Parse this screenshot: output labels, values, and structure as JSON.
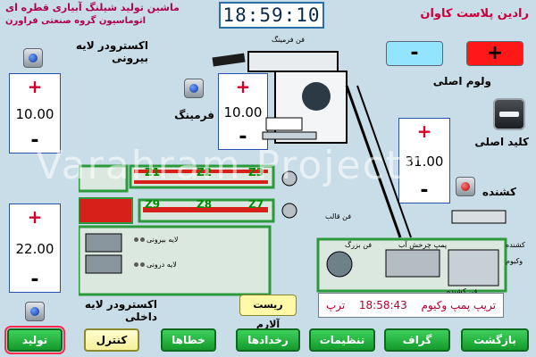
{
  "header": {
    "machine_name": "ماشین تولید شیلنگ آبیاری قطره ای",
    "automation_group": "اتوماسیون گروه صنعتی فراورن",
    "clock": "18:59:10",
    "brand": "رادین پلاست کاوان"
  },
  "main_volume": {
    "label": "ولوم اصلی",
    "minus": "-",
    "plus": "+"
  },
  "main_key": {
    "label": "کلید اصلی"
  },
  "outer_extruder": {
    "label": "اکسترودر لایه بیرونی",
    "plus": "+",
    "value": "10.00",
    "minus": "-"
  },
  "forming": {
    "label": "فرمینگ",
    "plus": "+",
    "value": "10.00",
    "minus": "-",
    "fan_label": "فن فرمینگ"
  },
  "puller": {
    "label": "کشنده",
    "plus": "+",
    "value": "31.00",
    "minus": "-"
  },
  "inner_extruder": {
    "label": "اکسترودر لایه داخلی",
    "plus": "+",
    "value": "22.00",
    "minus": "-"
  },
  "zones_top": [
    "Z1",
    "Z2",
    "Z3"
  ],
  "zones_bottom": [
    "Z9",
    "Z8",
    "Z7"
  ],
  "heater_panel": {
    "outer_layer": "لایه بیرونی",
    "inner_layer": "لایه درونی"
  },
  "machine_labels": {
    "fan_mold": "فن قالب",
    "big_fan": "فن بزرگ",
    "water_pump": "پمپ چرخش آب",
    "puller_small": "کشنده",
    "vacuum": "وکیوم",
    "fan_puller": "فن کشنده"
  },
  "alarm_reset": "ریست آلارم",
  "message": {
    "time": "18:58:43",
    "text": "تریپ پمپ وکیوم",
    "unit": "ترپ"
  },
  "watermark": "Varahram Projects",
  "nav": [
    {
      "label": "تولید",
      "key": "production"
    },
    {
      "label": "کنترل",
      "key": "control"
    },
    {
      "label": "خطاها",
      "key": "errors"
    },
    {
      "label": "رخدادها",
      "key": "events"
    },
    {
      "label": "تنظیمات",
      "key": "settings"
    },
    {
      "label": "گراف",
      "key": "graph"
    },
    {
      "label": "بازگشت",
      "key": "back"
    }
  ]
}
